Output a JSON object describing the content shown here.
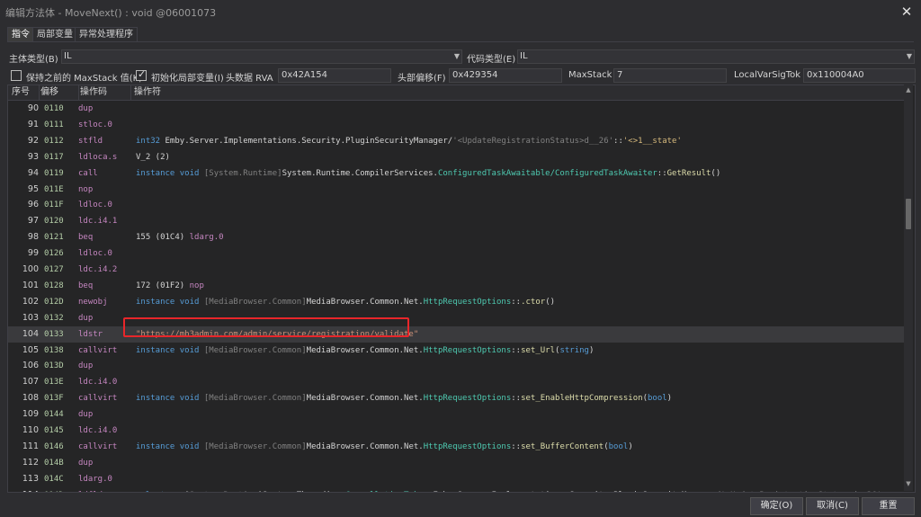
{
  "window": {
    "title": "编辑方法体 - MoveNext() : void @06001073",
    "close_glyph": "✕"
  },
  "tabs": [
    "指令",
    "局部变量",
    "异常处理程序"
  ],
  "header": {
    "body_type_label": "主体类型(B)",
    "body_type_value": "IL",
    "code_type_label": "代码类型(E)",
    "code_type_value": "IL",
    "keep_maxstack_label": "保持之前的 MaxStack 值(K)",
    "keep_maxstack_checked": false,
    "init_locals_label": "初始化局部变量(I)",
    "init_locals_checked": true,
    "header_rva_label": "头数据 RVA",
    "header_rva_value": "0x42A154",
    "header_offset_label": "头部偏移(F)",
    "header_offset_value": "0x429354",
    "maxstack_label": "MaxStack",
    "maxstack_value": "7",
    "localvarsig_label": "LocalVarSigTok",
    "localvarsig_value": "0x110004A0"
  },
  "grid": {
    "columns": [
      "序号",
      "偏移",
      "操作码",
      "操作符"
    ],
    "selected_index": "104",
    "rows": [
      {
        "idx": "90",
        "off": "0110",
        "op": "dup",
        "operand": []
      },
      {
        "idx": "91",
        "off": "0111",
        "op": "stloc.0",
        "operand": []
      },
      {
        "idx": "92",
        "off": "0112",
        "op": "stfld",
        "operand": [
          [
            "kw",
            "int32 "
          ],
          [
            "t",
            "Emby.Server.Implementations.Security.PluginSecurityManager/"
          ],
          [
            "asm",
            "'<UpdateRegistrationStatus>d__26'"
          ],
          [
            "t",
            "::"
          ],
          [
            "fld",
            "'<>1__state'"
          ]
        ]
      },
      {
        "idx": "93",
        "off": "0117",
        "op": "ldloca.s",
        "operand": [
          [
            "t",
            "V_2 (2)"
          ]
        ]
      },
      {
        "idx": "94",
        "off": "0119",
        "op": "call",
        "operand": [
          [
            "kw",
            "instance void "
          ],
          [
            "asm",
            "[System.Runtime]"
          ],
          [
            "t",
            "System.Runtime.CompilerServices."
          ],
          [
            "ty",
            "ConfiguredTaskAwaitable/ConfiguredTaskAwaiter"
          ],
          [
            "t",
            "::"
          ],
          [
            "fn",
            "GetResult"
          ],
          [
            "t",
            "()"
          ]
        ]
      },
      {
        "idx": "95",
        "off": "011E",
        "op": "nop",
        "operand": []
      },
      {
        "idx": "96",
        "off": "011F",
        "op": "ldloc.0",
        "operand": []
      },
      {
        "idx": "97",
        "off": "0120",
        "op": "ldc.i4.1",
        "operand": []
      },
      {
        "idx": "98",
        "off": "0121",
        "op": "beq",
        "operand": [
          [
            "t",
            "155 (01C4) "
          ],
          [
            "pl",
            "ldarg.0"
          ]
        ]
      },
      {
        "idx": "99",
        "off": "0126",
        "op": "ldloc.0",
        "operand": []
      },
      {
        "idx": "100",
        "off": "0127",
        "op": "ldc.i4.2",
        "operand": []
      },
      {
        "idx": "101",
        "off": "0128",
        "op": "beq",
        "operand": [
          [
            "t",
            "172 (01F2) "
          ],
          [
            "pl",
            "nop"
          ]
        ]
      },
      {
        "idx": "102",
        "off": "012D",
        "op": "newobj",
        "operand": [
          [
            "kw",
            "instance void "
          ],
          [
            "asm",
            "[MediaBrowser.Common]"
          ],
          [
            "t",
            "MediaBrowser.Common.Net."
          ],
          [
            "ty",
            "HttpRequestOptions"
          ],
          [
            "t",
            "::"
          ],
          [
            "fn",
            ".ctor"
          ],
          [
            "t",
            "()"
          ]
        ]
      },
      {
        "idx": "103",
        "off": "0132",
        "op": "dup",
        "operand": []
      },
      {
        "idx": "104",
        "off": "0133",
        "op": "ldstr",
        "operand": [
          [
            "str",
            "\"https://mb3admin.com/admin/service/registration/validate\""
          ]
        ]
      },
      {
        "idx": "105",
        "off": "0138",
        "op": "callvirt",
        "operand": [
          [
            "kw",
            "instance void "
          ],
          [
            "asm",
            "[MediaBrowser.Common]"
          ],
          [
            "t",
            "MediaBrowser.Common.Net."
          ],
          [
            "ty",
            "HttpRequestOptions"
          ],
          [
            "t",
            "::"
          ],
          [
            "fn",
            "set_Url"
          ],
          [
            "t",
            "("
          ],
          [
            "kw",
            "string"
          ],
          [
            "t",
            ")"
          ]
        ]
      },
      {
        "idx": "106",
        "off": "013D",
        "op": "dup",
        "operand": []
      },
      {
        "idx": "107",
        "off": "013E",
        "op": "ldc.i4.0",
        "operand": []
      },
      {
        "idx": "108",
        "off": "013F",
        "op": "callvirt",
        "operand": [
          [
            "kw",
            "instance void "
          ],
          [
            "asm",
            "[MediaBrowser.Common]"
          ],
          [
            "t",
            "MediaBrowser.Common.Net."
          ],
          [
            "ty",
            "HttpRequestOptions"
          ],
          [
            "t",
            "::"
          ],
          [
            "fn",
            "set_EnableHttpCompression"
          ],
          [
            "t",
            "("
          ],
          [
            "kw",
            "bool"
          ],
          [
            "t",
            ")"
          ]
        ]
      },
      {
        "idx": "109",
        "off": "0144",
        "op": "dup",
        "operand": []
      },
      {
        "idx": "110",
        "off": "0145",
        "op": "ldc.i4.0",
        "operand": []
      },
      {
        "idx": "111",
        "off": "0146",
        "op": "callvirt",
        "operand": [
          [
            "kw",
            "instance void "
          ],
          [
            "asm",
            "[MediaBrowser.Common]"
          ],
          [
            "t",
            "MediaBrowser.Common.Net."
          ],
          [
            "ty",
            "HttpRequestOptions"
          ],
          [
            "t",
            "::"
          ],
          [
            "fn",
            "set_BufferContent"
          ],
          [
            "t",
            "("
          ],
          [
            "kw",
            "bool"
          ],
          [
            "t",
            ")"
          ]
        ]
      },
      {
        "idx": "112",
        "off": "014B",
        "op": "dup",
        "operand": []
      },
      {
        "idx": "113",
        "off": "014C",
        "op": "ldarg.0",
        "operand": []
      },
      {
        "idx": "114",
        "off": "014D",
        "op": "ldfld",
        "operand": [
          [
            "kw",
            "valuetype "
          ],
          [
            "asm",
            "[System.Runtime]"
          ],
          [
            "t",
            "System.Threading."
          ],
          [
            "ty",
            "CancellationToken"
          ],
          [
            "t",
            " Emby.Server.Implementations.Security.PluginSecurityManager/"
          ],
          [
            "asm",
            "'<UpdateRegistrationStatus>d__26'"
          ],
          [
            "t",
            "::"
          ],
          [
            "fld",
            "cancellationToken"
          ]
        ]
      }
    ]
  },
  "buttons": {
    "ok": "确定(O)",
    "cancel": "取消(C)",
    "reset": "重置"
  },
  "colors": {
    "background": "#2d2d30",
    "grid": "#252526",
    "highlight_border": "#e8262a"
  }
}
